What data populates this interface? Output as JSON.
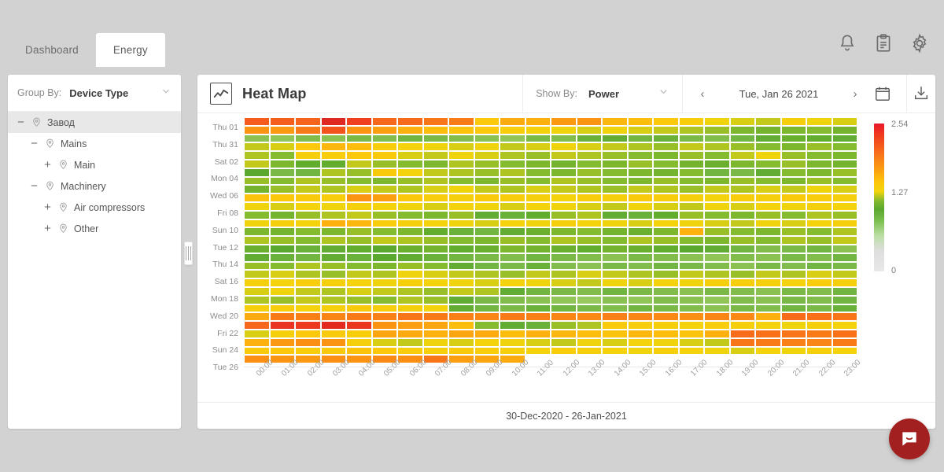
{
  "tabs": [
    {
      "label": "Dashboard",
      "active": false
    },
    {
      "label": "Energy",
      "active": true
    }
  ],
  "header_icons": [
    {
      "name": "bell-icon"
    },
    {
      "name": "clipboard-icon"
    },
    {
      "name": "gear-icon"
    }
  ],
  "sidebar": {
    "group_by_label": "Group By:",
    "group_by_value": "Device Type",
    "tree": [
      {
        "label": "Завод",
        "depth": 0,
        "toggle": "−",
        "selected": true
      },
      {
        "label": "Mains",
        "depth": 1,
        "toggle": "−",
        "selected": false
      },
      {
        "label": "Main",
        "depth": 2,
        "toggle": "+",
        "selected": false
      },
      {
        "label": "Machinery",
        "depth": 1,
        "toggle": "−",
        "selected": false
      },
      {
        "label": "Air compressors",
        "depth": 2,
        "toggle": "+",
        "selected": false
      },
      {
        "label": "Other",
        "depth": 2,
        "toggle": "+",
        "selected": false
      }
    ]
  },
  "panel": {
    "title": "Heat Map",
    "show_by_label": "Show By:",
    "show_by_value": "Power",
    "date_value": "Tue, Jan 26 2021",
    "prev_label": "‹",
    "next_label": "›",
    "calendar_icon": "calendar-icon",
    "download_icon": "download-icon",
    "footer_range": "30-Dec-2020 - 26-Jan-2021"
  },
  "chart_data": {
    "type": "heatmap",
    "title": "Heat Map",
    "xlabel": "",
    "ylabel": "",
    "metric": "Power",
    "date_range": "30-Dec-2020 - 26-Jan-2021",
    "grid": true,
    "legend_position": "right",
    "colorbar": {
      "ticks": [
        "2.54",
        "1.27",
        "0"
      ],
      "min": 0,
      "max": 2.54,
      "mid": 1.27,
      "colors": [
        "#e8172a",
        "#f7671b",
        "#fcc70c",
        "#5aa82e",
        "#bcdfa4",
        "#e2e2e2"
      ]
    },
    "x": [
      "00:00",
      "01:00",
      "02:00",
      "03:00",
      "04:00",
      "05:00",
      "06:00",
      "07:00",
      "08:00",
      "09:00",
      "10:00",
      "11:00",
      "12:00",
      "13:00",
      "14:00",
      "15:00",
      "16:00",
      "17:00",
      "18:00",
      "19:00",
      "20:00",
      "21:00",
      "22:00",
      "23:00"
    ],
    "y_ticks": [
      "Thu 01",
      "Thu 31",
      "Sat 02",
      "Mon 04",
      "Wed 06",
      "Fri 08",
      "Sun 10",
      "Tue 12",
      "Thu 14",
      "Sat 16",
      "Mon 18",
      "Wed 20",
      "Fri 22",
      "Sun 24",
      "Tue 26"
    ],
    "rows": 29,
    "cols": 24,
    "last_row_truncated_at": 10,
    "values": [
      [
        2.05,
        2.04,
        2.0,
        2.38,
        2.22,
        1.98,
        1.97,
        1.92,
        1.9,
        1.62,
        1.72,
        1.7,
        1.78,
        1.8,
        1.68,
        1.66,
        1.62,
        1.58,
        1.52,
        1.5,
        1.48,
        1.56,
        1.52,
        1.5
      ],
      [
        1.8,
        1.78,
        1.9,
        2.1,
        1.8,
        1.76,
        1.7,
        1.66,
        1.64,
        1.62,
        1.58,
        1.55,
        1.52,
        1.5,
        1.52,
        1.5,
        1.48,
        1.46,
        1.44,
        1.4,
        1.38,
        1.4,
        1.42,
        1.38
      ],
      [
        1.2,
        1.18,
        1.22,
        1.2,
        1.24,
        1.22,
        1.26,
        1.24,
        1.22,
        1.2,
        1.18,
        1.24,
        1.22,
        1.28,
        1.3,
        1.26,
        1.28,
        1.24,
        1.22,
        1.26,
        1.3,
        1.36,
        1.34,
        1.3
      ],
      [
        1.48,
        1.5,
        1.62,
        1.68,
        1.66,
        1.58,
        1.54,
        1.52,
        1.5,
        1.52,
        1.48,
        1.5,
        1.52,
        1.5,
        1.48,
        1.46,
        1.44,
        1.48,
        1.46,
        1.44,
        1.42,
        1.4,
        1.44,
        1.42
      ],
      [
        1.46,
        1.42,
        1.56,
        1.58,
        1.62,
        1.6,
        1.5,
        1.48,
        1.52,
        1.5,
        1.46,
        1.44,
        1.48,
        1.46,
        1.44,
        1.42,
        1.4,
        1.44,
        1.42,
        1.48,
        1.52,
        1.44,
        1.42,
        1.4
      ],
      [
        1.48,
        1.4,
        1.34,
        1.34,
        1.48,
        1.44,
        1.42,
        1.4,
        1.46,
        1.44,
        1.42,
        1.4,
        1.38,
        1.42,
        1.4,
        1.44,
        1.42,
        1.38,
        1.36,
        1.4,
        1.42,
        1.44,
        1.4,
        1.38
      ],
      [
        1.32,
        1.24,
        1.26,
        1.46,
        1.44,
        1.6,
        1.54,
        1.48,
        1.46,
        1.44,
        1.46,
        1.42,
        1.4,
        1.44,
        1.42,
        1.4,
        1.38,
        1.42,
        1.26,
        1.24,
        1.3,
        1.42,
        1.4,
        1.44
      ],
      [
        1.44,
        1.42,
        1.46,
        1.44,
        1.42,
        1.4,
        1.44,
        1.46,
        1.42,
        1.4,
        1.44,
        1.42,
        1.46,
        1.44,
        1.42,
        1.4,
        1.44,
        1.42,
        1.4,
        1.44,
        1.42,
        1.4,
        1.44,
        1.42
      ],
      [
        1.38,
        1.44,
        1.48,
        1.46,
        1.5,
        1.48,
        1.46,
        1.5,
        1.52,
        1.48,
        1.46,
        1.5,
        1.48,
        1.46,
        1.44,
        1.48,
        1.46,
        1.44,
        1.48,
        1.46,
        1.5,
        1.48,
        1.52,
        1.5
      ],
      [
        1.64,
        1.62,
        1.6,
        1.58,
        1.8,
        1.76,
        1.62,
        1.58,
        1.56,
        1.6,
        1.58,
        1.56,
        1.54,
        1.58,
        1.56,
        1.6,
        1.58,
        1.56,
        1.54,
        1.58,
        1.56,
        1.6,
        1.58,
        1.56
      ],
      [
        1.52,
        1.5,
        1.54,
        1.52,
        1.56,
        1.54,
        1.52,
        1.5,
        1.54,
        1.52,
        1.5,
        1.54,
        1.52,
        1.5,
        1.48,
        1.52,
        1.5,
        1.48,
        1.52,
        1.5,
        1.54,
        1.52,
        1.56,
        1.54
      ],
      [
        1.42,
        1.38,
        1.44,
        1.46,
        1.48,
        1.44,
        1.42,
        1.4,
        1.44,
        1.3,
        1.28,
        1.34,
        1.44,
        1.46,
        1.3,
        1.28,
        1.34,
        1.44,
        1.42,
        1.4,
        1.44,
        1.42,
        1.46,
        1.44
      ],
      [
        1.52,
        1.56,
        1.54,
        1.7,
        1.68,
        1.58,
        1.56,
        1.54,
        1.52,
        1.5,
        1.54,
        1.52,
        1.56,
        1.54,
        1.52,
        1.5,
        1.54,
        1.52,
        1.5,
        1.48,
        1.52,
        1.5,
        1.54,
        1.56
      ],
      [
        1.4,
        1.38,
        1.42,
        1.4,
        1.44,
        1.42,
        1.4,
        1.34,
        1.28,
        1.26,
        1.3,
        1.36,
        1.4,
        1.42,
        1.38,
        1.36,
        1.4,
        1.7,
        1.44,
        1.42,
        1.4,
        1.44,
        1.42,
        1.46
      ],
      [
        1.46,
        1.44,
        1.42,
        1.46,
        1.44,
        1.48,
        1.46,
        1.44,
        1.42,
        1.4,
        1.44,
        1.42,
        1.46,
        1.44,
        1.42,
        1.46,
        1.44,
        1.42,
        1.4,
        1.44,
        1.42,
        1.46,
        1.44,
        1.48
      ],
      [
        1.36,
        1.32,
        1.28,
        1.3,
        1.34,
        1.32,
        1.36,
        1.38,
        1.34,
        1.36,
        1.4,
        1.38,
        1.36,
        1.34,
        1.38,
        1.36,
        1.34,
        1.32,
        1.3,
        1.26,
        1.22,
        1.24,
        1.26,
        1.2
      ],
      [
        1.3,
        1.28,
        1.26,
        1.3,
        1.28,
        1.32,
        1.3,
        1.28,
        1.26,
        1.24,
        1.22,
        1.26,
        1.24,
        1.22,
        1.2,
        1.24,
        1.22,
        1.2,
        1.18,
        1.22,
        1.2,
        1.24,
        1.22,
        1.26
      ],
      [
        1.44,
        1.42,
        1.46,
        1.44,
        1.42,
        1.4,
        1.44,
        1.42,
        1.3,
        1.26,
        1.24,
        1.28,
        1.22,
        1.2,
        1.24,
        1.22,
        1.26,
        1.24,
        1.22,
        1.2,
        1.24,
        1.22,
        1.26,
        1.24
      ],
      [
        1.48,
        1.5,
        1.46,
        1.44,
        1.48,
        1.46,
        1.52,
        1.5,
        1.48,
        1.46,
        1.44,
        1.48,
        1.46,
        1.5,
        1.48,
        1.46,
        1.44,
        1.48,
        1.46,
        1.44,
        1.48,
        1.46,
        1.5,
        1.48
      ],
      [
        1.56,
        1.54,
        1.58,
        1.56,
        1.54,
        1.52,
        1.56,
        1.54,
        1.52,
        1.5,
        1.54,
        1.52,
        1.5,
        1.48,
        1.52,
        1.5,
        1.54,
        1.52,
        1.56,
        1.58,
        1.56,
        1.54,
        1.58,
        1.56
      ],
      [
        1.5,
        1.52,
        1.48,
        1.46,
        1.5,
        1.48,
        1.46,
        1.44,
        1.48,
        1.46,
        1.3,
        1.26,
        1.24,
        1.22,
        1.26,
        1.24,
        1.22,
        1.2,
        1.24,
        1.22,
        1.2,
        1.24,
        1.22,
        1.26
      ],
      [
        1.46,
        1.44,
        1.48,
        1.46,
        1.44,
        1.42,
        1.46,
        1.44,
        1.3,
        1.24,
        1.22,
        1.2,
        1.18,
        1.16,
        1.2,
        1.18,
        1.22,
        1.2,
        1.18,
        1.22,
        1.2,
        1.24,
        1.22,
        1.26
      ],
      [
        1.56,
        1.58,
        1.54,
        1.56,
        1.6,
        1.58,
        1.56,
        1.54,
        1.3,
        1.26,
        1.24,
        1.28,
        1.26,
        1.24,
        1.22,
        1.26,
        1.24,
        1.22,
        1.2,
        1.24,
        1.22,
        1.26,
        1.24,
        1.28
      ],
      [
        1.72,
        1.9,
        1.88,
        1.86,
        1.9,
        1.88,
        1.92,
        1.9,
        1.88,
        1.86,
        1.9,
        1.88,
        1.86,
        1.84,
        1.88,
        1.86,
        1.84,
        1.82,
        1.86,
        1.84,
        1.7,
        1.96,
        1.94,
        1.92
      ],
      [
        1.98,
        2.3,
        2.26,
        2.36,
        2.28,
        1.8,
        1.76,
        1.74,
        1.66,
        1.42,
        1.3,
        1.28,
        1.44,
        1.46,
        1.6,
        1.58,
        1.56,
        1.54,
        1.58,
        1.56,
        1.54,
        1.52,
        1.56,
        1.54
      ],
      [
        1.5,
        1.56,
        1.62,
        1.6,
        1.58,
        1.74,
        1.72,
        1.7,
        1.74,
        1.72,
        1.66,
        1.7,
        1.68,
        1.66,
        1.64,
        1.68,
        1.66,
        1.64,
        1.7,
        1.96,
        1.94,
        1.92,
        1.9,
        1.94
      ],
      [
        1.7,
        1.78,
        1.82,
        1.8,
        1.56,
        1.5,
        1.48,
        1.52,
        1.5,
        1.54,
        1.52,
        1.5,
        1.48,
        1.52,
        1.5,
        1.54,
        1.52,
        1.5,
        1.48,
        1.92,
        1.9,
        1.88,
        1.86,
        1.9
      ],
      [
        1.6,
        1.62,
        1.58,
        1.6,
        1.64,
        1.62,
        1.58,
        1.56,
        1.6,
        1.58,
        1.56,
        1.54,
        1.58,
        1.56,
        1.54,
        1.52,
        1.56,
        1.54,
        1.52,
        1.5,
        1.54,
        1.52,
        1.56,
        1.54
      ],
      [
        1.82,
        1.8,
        1.78,
        1.82,
        1.8,
        1.84,
        1.82,
        1.92,
        1.76,
        1.74,
        1.72,
        null,
        null,
        null,
        null,
        null,
        null,
        null,
        null,
        null,
        null,
        null,
        null,
        null
      ]
    ]
  },
  "chat": {
    "icon": "chat-bubble-icon"
  }
}
